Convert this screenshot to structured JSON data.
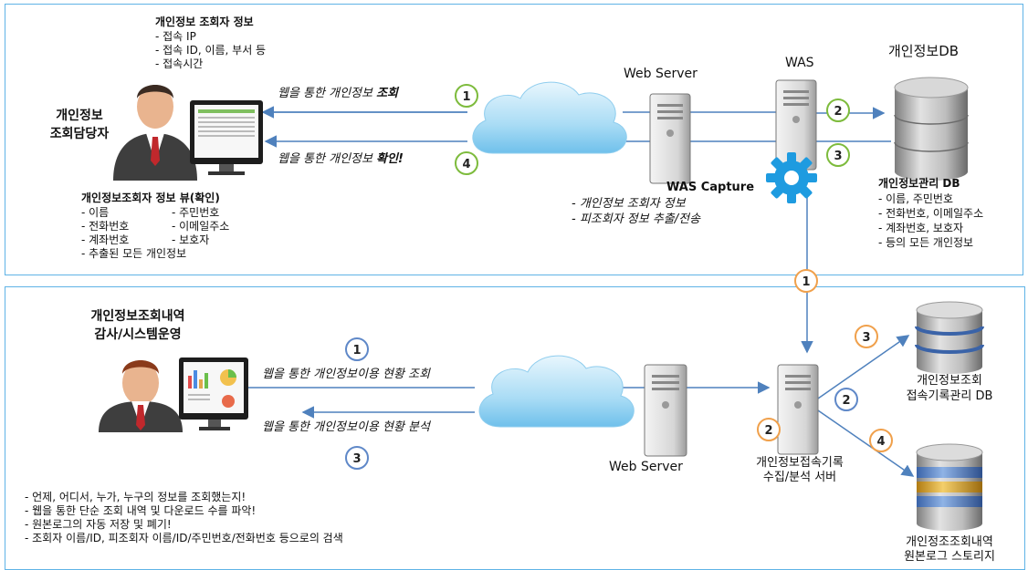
{
  "top": {
    "viewer_info_title": "개인정보 조회자 정보",
    "viewer_info_items": [
      "- 접속 IP",
      "- 접속 ID, 이름, 부서 등",
      "- 접속시간"
    ],
    "actor_label_1": "개인정보",
    "actor_label_2": "조회담당자",
    "arrow1_text": "웹을 통한 개인정보 ",
    "arrow1_bold": "조회",
    "arrow4_text": "웹을 통한 개인정보 ",
    "arrow4_bold": "확인!",
    "view_title": "개인정보조회자 정보 뷰(확인)",
    "view_col1": [
      "- 이름",
      "- 전화번호",
      "- 계좌번호",
      "- 추출된 모든 개인정보"
    ],
    "view_col2": [
      "- 주민번호",
      "- 이메일주소",
      "- 보호자"
    ],
    "web_server_label": "Web Server",
    "was_label": "WAS",
    "db_label": "개인정보DB",
    "was_capture_label": "WAS Capture",
    "was_capture_items": [
      "- 개인정보 조회자 정보",
      "- 피조회자 정보 추출/전송"
    ],
    "db_mgmt_title": "개인정보관리 DB",
    "db_mgmt_items": [
      "- 이름, 주민번호",
      "- 전화번호, 이메일주소",
      "- 계좌번호, 보호자",
      "- 등의 모든 개인정보"
    ],
    "badges": [
      "1",
      "2",
      "3",
      "4"
    ]
  },
  "connector_badge": "1",
  "bottom": {
    "actor_label_1": "개인정보조회내역",
    "actor_label_2": "감사/시스템운영",
    "arrow1_text": "웹을 통한 개인정보이용 현황 조회",
    "arrow3_text": "웹을 통한 개인정보이용 현황 분석",
    "badges": [
      "1",
      "3",
      "2",
      "2",
      "3",
      "4"
    ],
    "web_server_label": "Web Server",
    "server_label_1": "개인정보접속기록",
    "server_label_2": "수집/분석 서버",
    "db1_label_1": "개인정보조회",
    "db1_label_2": "접속기록관리 DB",
    "db2_label_1": "개인정조조회내역",
    "db2_label_2": "원본로그 스토리지",
    "notes": [
      "- 언제, 어디서, 누가, 누구의 정보를 조회했는지!",
      "- 웹을 통한 단순 조회 내역 및 다운로드 수를 파악!",
      "- 원본로그의 자동 저장 및 폐기!",
      "- 조회자 이름/ID, 피조회자 이름/ID/주민번호/전화번호 등으로의 검색"
    ]
  },
  "colors": {
    "panel_border": "#5fb3e6",
    "arrow": "#4f81bd",
    "green": "#7dbb3c",
    "orange": "#f0a04b",
    "blue": "#5f88c8",
    "gear": "#1e9be0"
  },
  "icons": [
    "person-icon",
    "monitor-icon",
    "cloud-icon",
    "server-icon",
    "database-icon",
    "gear-icon"
  ]
}
